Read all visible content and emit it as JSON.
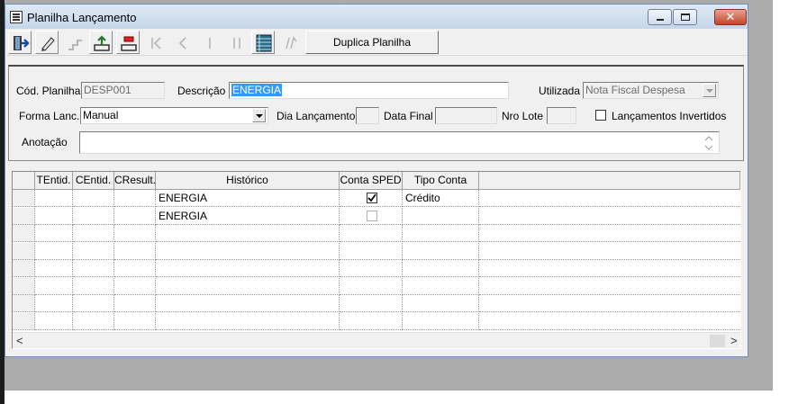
{
  "window": {
    "title": "Planilha Lançamento",
    "minimize": "minimize",
    "maximize": "maximize",
    "close": "✕"
  },
  "toolbar": {
    "buttons": [
      {
        "name": "exit-icon",
        "enabled": true
      },
      {
        "name": "pencil-icon",
        "enabled": true
      },
      {
        "name": "steps-icon",
        "enabled": false
      },
      {
        "name": "tray-upload-icon",
        "enabled": true
      },
      {
        "name": "tray-red-icon",
        "enabled": true
      },
      {
        "name": "first-record-icon",
        "enabled": false
      },
      {
        "name": "prev-record-icon",
        "enabled": false
      },
      {
        "name": "next-record-icon",
        "enabled": false
      },
      {
        "name": "last-record-icon",
        "enabled": false
      },
      {
        "name": "grid-view-icon",
        "enabled": true
      },
      {
        "name": "undo-icon",
        "enabled": false
      }
    ],
    "duplicate_label": "Duplica Planilha"
  },
  "form": {
    "cod_label": "Cód. Planilha",
    "cod_value": "DESP001",
    "desc_label": "Descrição",
    "desc_value": "ENERGIA",
    "utilizada_label": "Utilizada",
    "utilizada_value": "Nota Fiscal Despesa",
    "forma_label": "Forma Lanc.",
    "forma_value": "Manual",
    "dia_label": "Dia Lançamento",
    "dia_value": "",
    "data_final_label": "Data Final",
    "data_final_value": "",
    "nro_lote_label": "Nro Lote",
    "nro_lote_value": "",
    "invertidos_label": "Lançamentos Invertidos",
    "invertidos_checked": false,
    "anotacao_label": "Anotação",
    "anotacao_value": ""
  },
  "grid": {
    "columns": [
      "",
      "TEntid.",
      "CEntid.",
      "CResult.",
      "Histórico",
      "Conta SPED",
      "Tipo Conta",
      ""
    ],
    "rows": [
      {
        "tentid": "",
        "centid": "",
        "cresult": "",
        "historico": "ENERGIA",
        "conta_sped": true,
        "tipo_conta": "Crédito"
      },
      {
        "tentid": "",
        "centid": "",
        "cresult": "",
        "historico": "ENERGIA",
        "conta_sped": false,
        "tipo_conta": ""
      },
      {
        "tentid": "",
        "centid": "",
        "cresult": "",
        "historico": "",
        "conta_sped": null,
        "tipo_conta": ""
      },
      {
        "tentid": "",
        "centid": "",
        "cresult": "",
        "historico": "",
        "conta_sped": null,
        "tipo_conta": ""
      },
      {
        "tentid": "",
        "centid": "",
        "cresult": "",
        "historico": "",
        "conta_sped": null,
        "tipo_conta": ""
      },
      {
        "tentid": "",
        "centid": "",
        "cresult": "",
        "historico": "",
        "conta_sped": null,
        "tipo_conta": ""
      },
      {
        "tentid": "",
        "centid": "",
        "cresult": "",
        "historico": "",
        "conta_sped": null,
        "tipo_conta": ""
      },
      {
        "tentid": "",
        "centid": "",
        "cresult": "",
        "historico": "",
        "conta_sped": null,
        "tipo_conta": ""
      }
    ],
    "scroll_left": "<",
    "scroll_right": ">"
  },
  "colors": {
    "selection": "#3399ff",
    "window_bg": "#f0f0f0",
    "close_button": "#c4442a"
  }
}
